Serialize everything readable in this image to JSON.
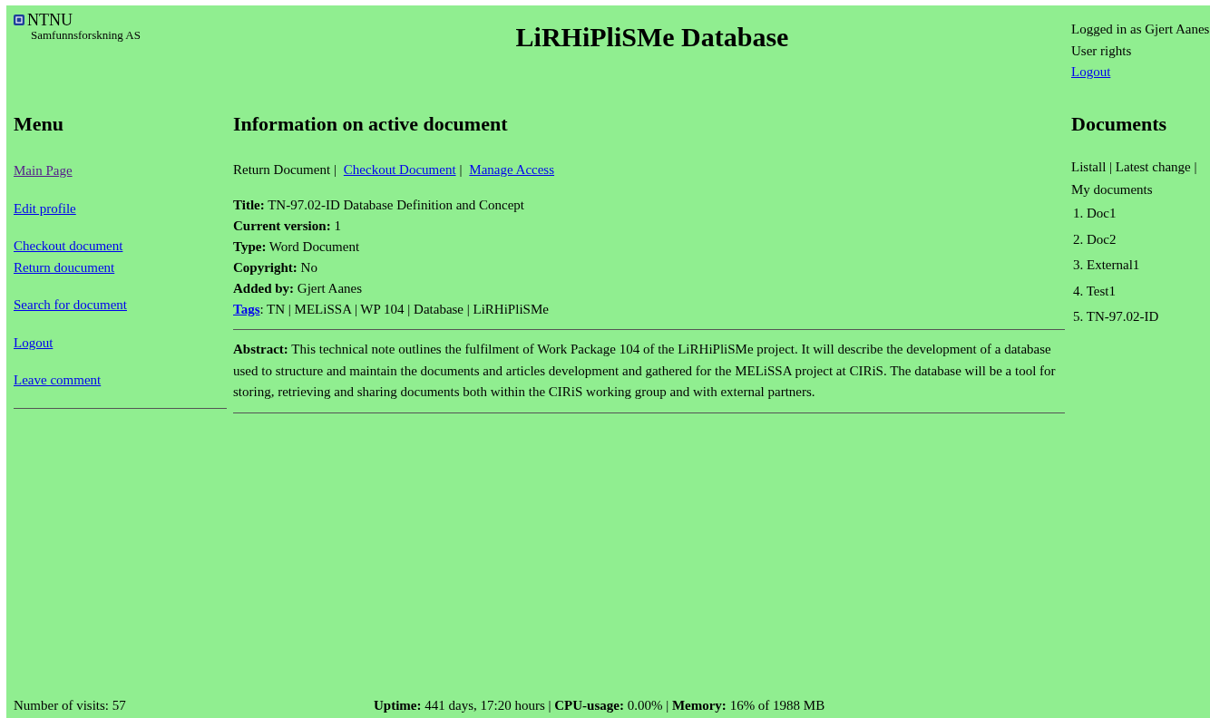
{
  "logo": {
    "name": "NTNU",
    "subtitle": "Samfunnsforskning AS"
  },
  "site_title": "LiRHiPliSMe Database",
  "user": {
    "logged_in": "Logged in as Gjert Aanes",
    "rights": "User rights",
    "logout": "Logout"
  },
  "menu": {
    "heading": "Menu",
    "groups": [
      [
        {
          "label": "Main Page",
          "visited": true
        }
      ],
      [
        {
          "label": "Edit profile",
          "visited": false
        }
      ],
      [
        {
          "label": "Checkout document",
          "visited": false
        },
        {
          "label": "Return doucument",
          "visited": false
        }
      ],
      [
        {
          "label": "Search for document",
          "visited": false
        }
      ],
      [
        {
          "label": "Logout",
          "visited": false
        }
      ],
      [
        {
          "label": "Leave comment",
          "visited": false
        }
      ]
    ]
  },
  "document": {
    "heading": "Information on active document",
    "action_separator": "|",
    "actions": [
      {
        "label": "Return Document",
        "link": false
      },
      {
        "label": "Checkout Document",
        "link": true
      },
      {
        "label": "Manage Access",
        "link": true
      }
    ],
    "fields": [
      {
        "label": "Title:",
        "value": "TN-97.02-ID Database Definition and Concept"
      },
      {
        "label": "Current version:",
        "value": "1"
      },
      {
        "label": "Type:",
        "value": "Word Document"
      },
      {
        "label": "Copyright:",
        "value": "No"
      },
      {
        "label": "Added by:",
        "value": "Gjert Aanes"
      }
    ],
    "tags": {
      "label": "Tags",
      "value": ": TN | MELiSSA | WP 104 | Database | LiRHiPliSMe"
    },
    "abstract": "**Abstract:** This technical note outlines the fulfilment of Work Package 104 of the LiRHiPliSMe project. It will describe the development of a database used to structure and maintain the documents and articles development and gathered for the MELiSSA project at CIRiS. The database will be a tool for storing, retrieving and sharing documents both within the CIRiS working group and with external partners."
  },
  "documents": {
    "heading": "Documents",
    "filters": "Listall | Latest change | My documents",
    "items": [
      "1. Doc1",
      "2. Doc2",
      "3. External1",
      "4. Test1",
      "5. TN-97.02-ID"
    ]
  },
  "footer": {
    "visits": "Number of visits: 57",
    "stats": "**Uptime:** 441 days, 17:20 hours | **CPU-usage:** 0.00% | **Memory:** 16% of 1988 MB"
  }
}
